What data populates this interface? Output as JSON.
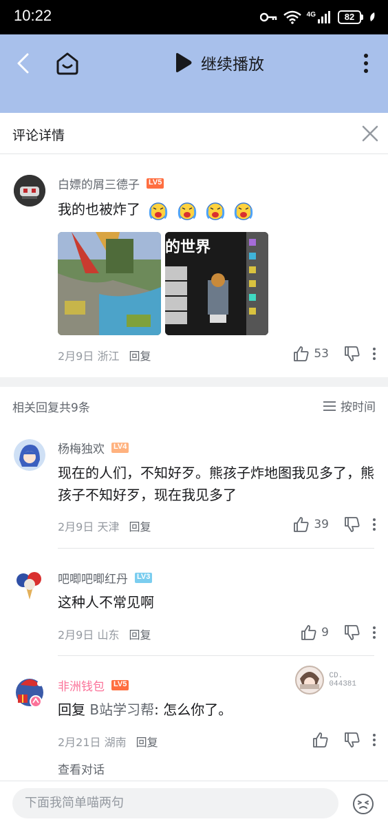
{
  "status_bar": {
    "time": "10:22",
    "battery": "82",
    "network": "4G"
  },
  "top_bar": {
    "continue_play": "继续播放"
  },
  "panel": {
    "title": "评论详情"
  },
  "main_comment": {
    "username": "白嫖的屑三德子",
    "level": "LV5",
    "level_color": "#ff6e40",
    "text": "我的也被炸了",
    "date": "2月9日",
    "location": "浙江",
    "reply_label": "回复",
    "likes": "53",
    "image_1_alt": "minecraft-map-screenshot",
    "image_2_caption": "的世界"
  },
  "replies_header": {
    "count": "相关回复共9条",
    "sort": "按时间"
  },
  "replies": [
    {
      "username": "杨梅独欢",
      "level": "LV4",
      "level_color": "#ffb27f",
      "text": "现在的人们，不知好歹。熊孩子炸地图我见多了，熊孩子不知好歹，现在我见多了",
      "date": "2月9日",
      "location": "天津",
      "reply_label": "回复",
      "likes": "39"
    },
    {
      "username": "吧唧吧唧红丹",
      "level": "LV3",
      "level_color": "#7bcdef",
      "text": "这种人不常见啊",
      "date": "2月9日",
      "location": "山东",
      "reply_label": "回复",
      "likes": "9"
    },
    {
      "username": "非洲钱包",
      "level": "LV5",
      "level_color": "#ff6e40",
      "reply_prefix": "回复 ",
      "reply_target": "B站学习帮",
      "text": ": 怎么你了。",
      "date": "2月21日",
      "location": "湖南",
      "reply_label": "回复",
      "likes": "",
      "fan_badge_no": "CD.\n044381",
      "view_conversation": "查看对话"
    }
  ],
  "bottom_bar": {
    "placeholder": "下面我简单喵两句"
  },
  "colors": {
    "accent_bar": "#a8c0eb",
    "pink": "#fb7299",
    "text_secondary": "#61666d",
    "text_muted": "#9499a0"
  }
}
